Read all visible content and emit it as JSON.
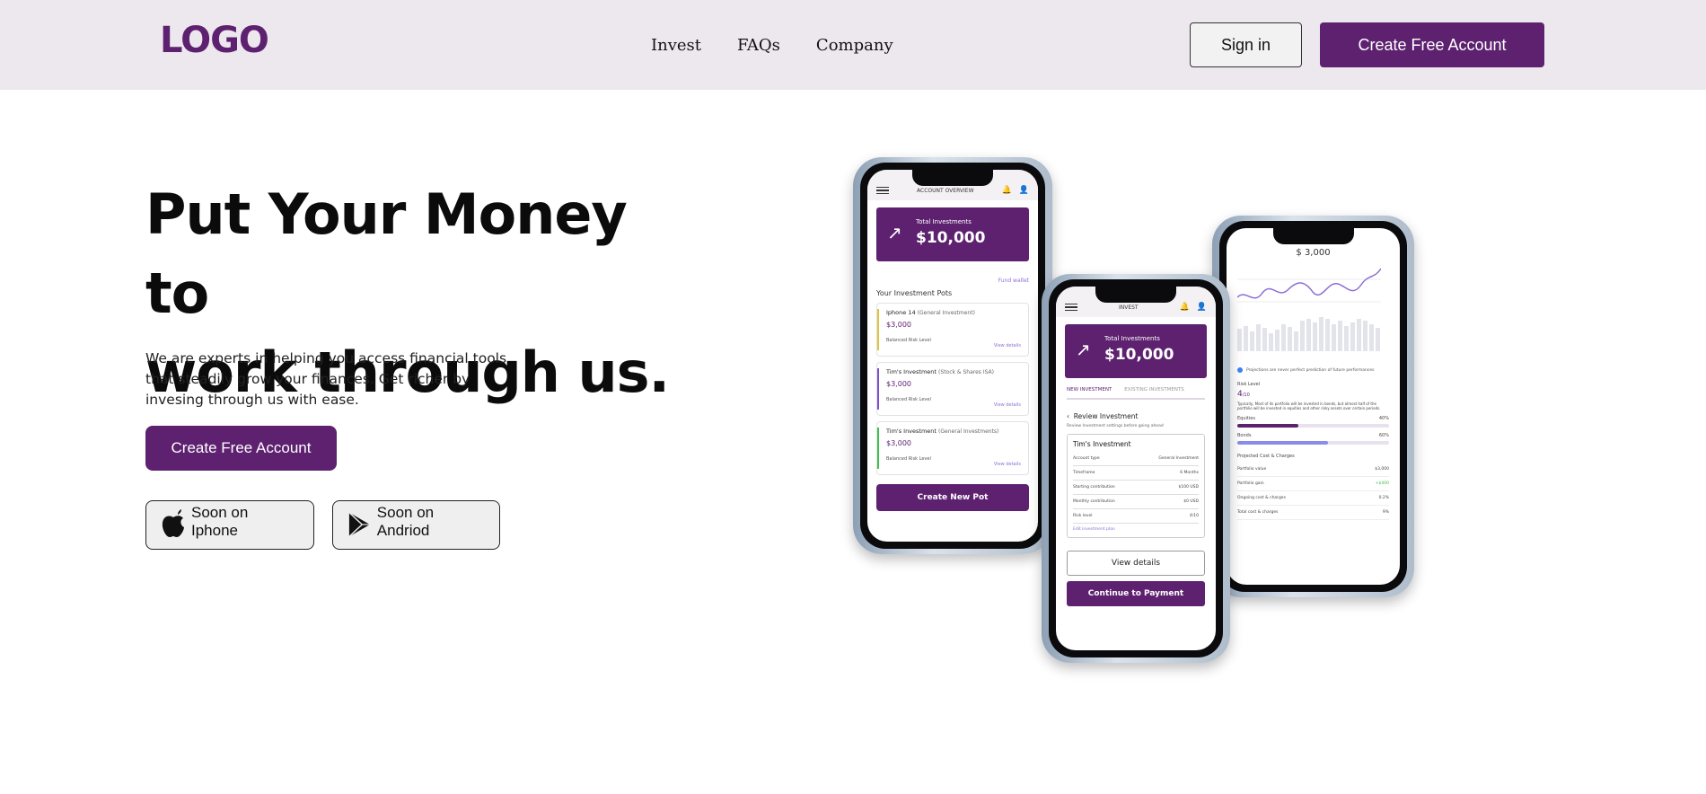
{
  "nav": {
    "logo": "LOGO",
    "links": [
      "Invest",
      "FAQs",
      "Company"
    ],
    "sign_in": "Sign in",
    "create_account": "Create Free Account"
  },
  "hero": {
    "title_line1": "Put Your Money to",
    "title_line2": "work through us.",
    "subtitle": "We are experts in helping you access financial tools that steadily grow your finances. Get richer by invesing through us with ease.",
    "cta": "Create Free Account",
    "ios_store": "Soon on Iphone",
    "android_store": "Soon on Andriod"
  },
  "colors": {
    "brand": "#5e2170",
    "nav_bg": "#ede8ee"
  },
  "phone1": {
    "header": "ACCOUNT OVERVIEW",
    "total_label": "Total Investments",
    "total_value": "$10,000",
    "total_link": "Fund wallet",
    "pots_title": "Your Investment Pots",
    "pots": [
      {
        "name": "Iphone 14",
        "type": "(General Investment)",
        "amount": "$3,000",
        "risk": "Balanced Risk Level",
        "link": "View details",
        "color": "#e0c341"
      },
      {
        "name": "Tim's Investment",
        "type": "(Stock & Shares ISA)",
        "amount": "$3,000",
        "risk": "Balanced Risk Level",
        "link": "View details",
        "color": "#7c4fd1"
      },
      {
        "name": "Tim's Investment",
        "type": "(General Investments)",
        "amount": "$3,000",
        "risk": "Balanced Risk Level",
        "link": "View details",
        "color": "#3fbf4c"
      }
    ],
    "button": "Create New Pot"
  },
  "phone2": {
    "header": "INVEST",
    "total_label": "Total Investments",
    "total_value": "$10,000",
    "tab_active": "NEW INVESTMENT",
    "tab_other": "EXISTING INVESTMENTS",
    "review_title": "Review Investment",
    "review_sub": "Review Investment settings before going ahead",
    "table_title": "Tim's Investment",
    "rows": [
      [
        "Account type",
        "General Investment"
      ],
      [
        "Timeframe",
        "6 Months"
      ],
      [
        "Starting contribution",
        "$100 USD"
      ],
      [
        "Monthly contribution",
        "$0 USD"
      ],
      [
        "Risk level",
        "4/10"
      ]
    ],
    "edit_link": "Edit investment plan",
    "view_details": "View details",
    "continue": "Continue to Payment"
  },
  "phone3": {
    "amount": "$ 3,000",
    "projection_note": "Projections are never perfect prediction of future performances",
    "risk_label": "Risk Level",
    "risk_value": "4",
    "risk_suffix": "/10",
    "risk_desc": "Typically, Most of its portfolio will be invested in bonds, but almost half of the portfolio will be invested in equities and other risky assets over certain periods.",
    "equities_label": "Equities",
    "equities_pct": "40%",
    "equities_fill": 0.4,
    "bonds_label": "Bonds",
    "bonds_pct": "60%",
    "bonds_fill": 0.6,
    "costs_title": "Projected Cost & Charges",
    "costs_rows": [
      [
        "Portfolio value",
        "$3,000"
      ],
      [
        "Portfolio gain",
        "+$400"
      ],
      [
        "Ongoing cost & charges",
        "0.2%"
      ],
      [
        "Total cost & charges",
        "9%"
      ]
    ]
  }
}
